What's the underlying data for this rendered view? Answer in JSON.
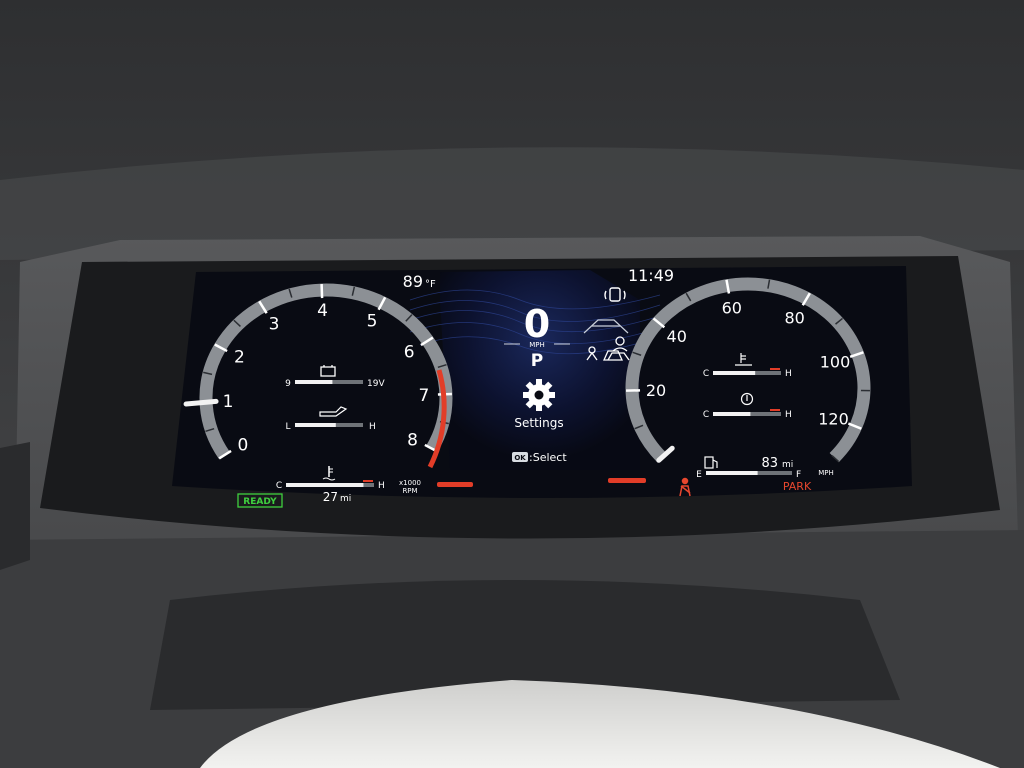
{
  "status_bar": {
    "outside_temp_value": "89",
    "outside_temp_unit": "°F",
    "clock": "11:49"
  },
  "tachometer": {
    "tick_labels": [
      "0",
      "1",
      "2",
      "3",
      "4",
      "5",
      "6",
      "7",
      "8"
    ],
    "needle_value": 1,
    "redline_from": 6,
    "unit_line1": "x1000",
    "unit_line2": "RPM",
    "ready_label": "READY",
    "battery_gauge": {
      "min_label": "9",
      "max_label": "19V",
      "level": 0.55
    },
    "oil_pressure_gauge": {
      "min_label": "L",
      "max_label": "H",
      "level": 0.6
    },
    "coolant_temp_gauge": {
      "min_label": "C",
      "max_label": "H",
      "level": 0.88
    },
    "range_value": "27",
    "range_unit": "mi"
  },
  "center_panel": {
    "speed_value": "0",
    "speed_unit": "MPH",
    "gear": "P",
    "menu_title": "Settings",
    "menu_icon": "gear-icon",
    "ok_key_label": "OK",
    "ok_hint": ":Select",
    "top_icon": "vehicle-connect-icon",
    "adas_icons": [
      "lane-departure-icon",
      "driver-attention-icon",
      "pre-collision-icon"
    ]
  },
  "speedometer": {
    "tick_labels": [
      "20",
      "40",
      "60",
      "80",
      "100",
      "120"
    ],
    "needle_value": 0,
    "max_value": 130,
    "unit": "MPH",
    "transmission_temp_gauge": {
      "min_label": "C",
      "max_label": "H",
      "level": 0.62
    },
    "differential_temp_gauge": {
      "min_label": "C",
      "max_label": "H",
      "level": 0.55
    },
    "fuel_gauge": {
      "min_label": "E",
      "max_label": "F",
      "level": 0.6
    },
    "fuel_range_value": "83",
    "fuel_range_unit": "mi",
    "park_label": "PARK",
    "seatbelt_icon": "seatbelt-warning-icon"
  },
  "colors": {
    "screen_bg": "#0a0d16",
    "ring_grey": "#8c9095",
    "redline": "#e23d28",
    "ready_green": "#3fd13f",
    "park_red": "#e8472e",
    "accent_blue": "#1e2a66"
  }
}
